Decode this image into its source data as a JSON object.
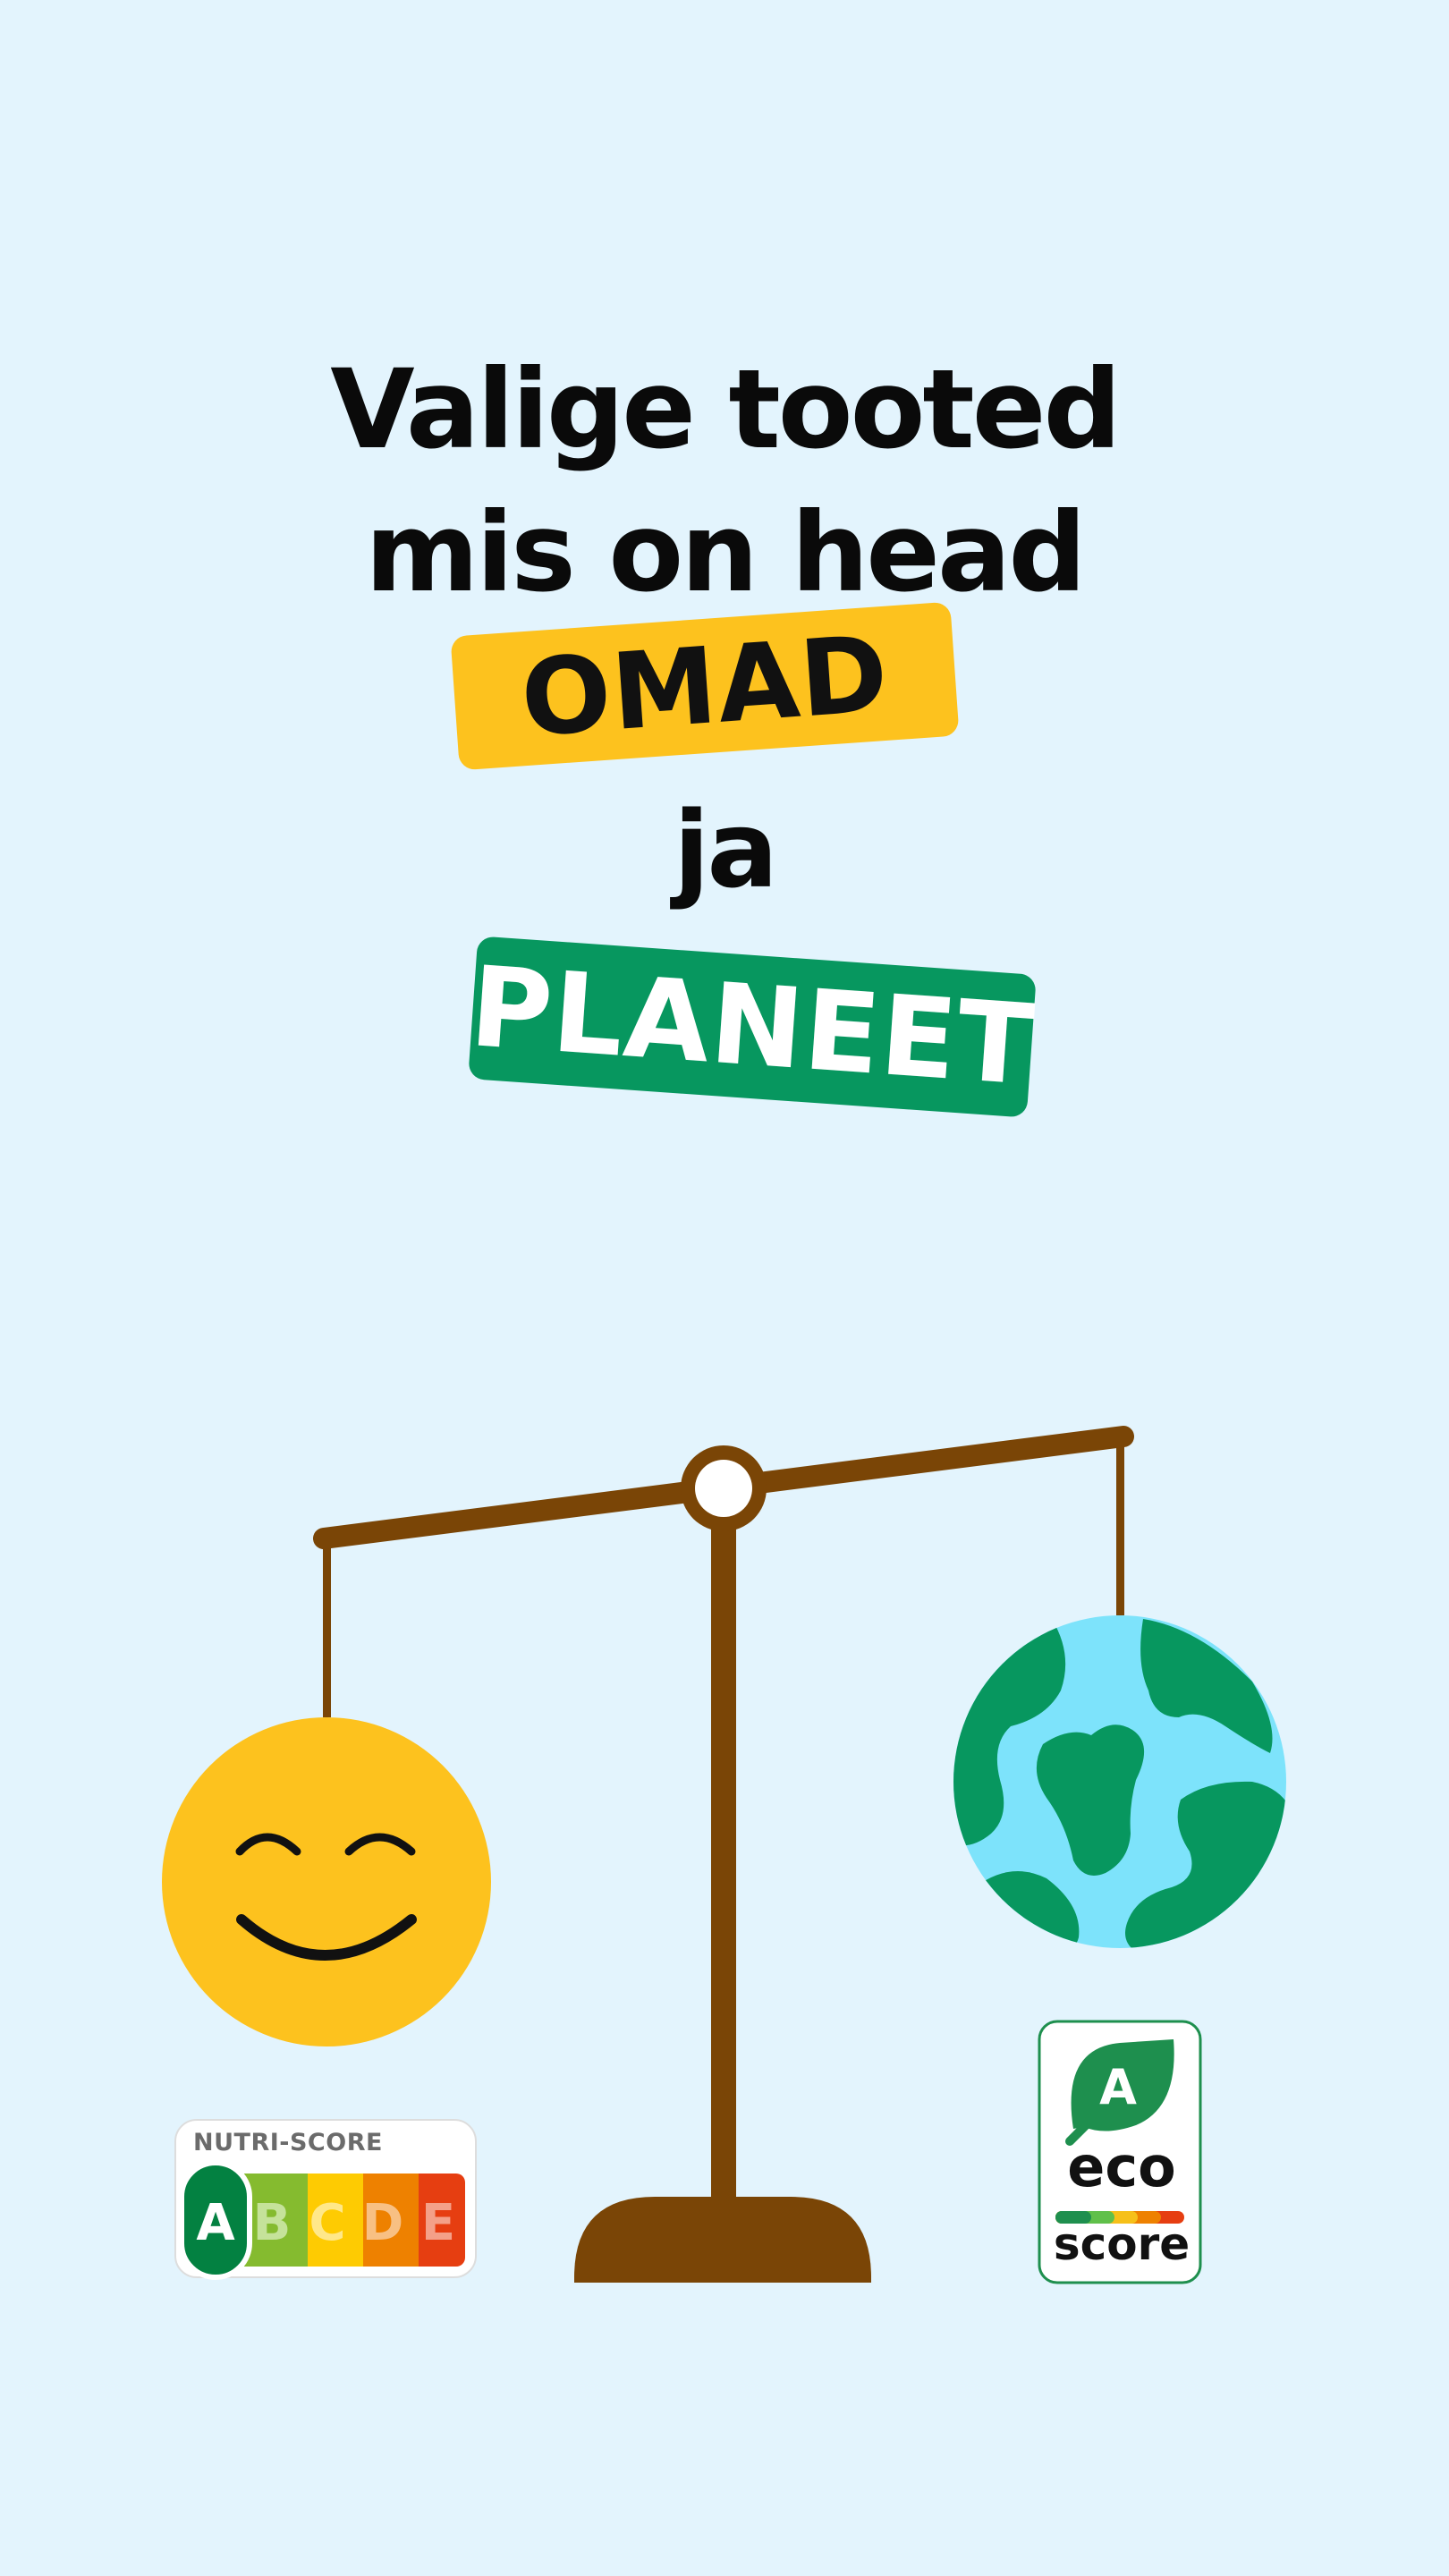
{
  "headline": {
    "line1": "Valige tooted",
    "line2": "mis on head",
    "highlight1": "OMAD",
    "connector": "ja",
    "highlight2": "PLANEET"
  },
  "colors": {
    "background": "#E3F4FD",
    "yellow": "#FDC21E",
    "green": "#07975F",
    "scale": "#7A4506",
    "earth_water": "#7DE3FB",
    "earth_land": "#07975F"
  },
  "illustration": {
    "scale_icon": "balance-scale-icon",
    "left_pan_icon": "smiley-face-icon",
    "right_pan_icon": "earth-globe-icon"
  },
  "nutri_score": {
    "title": "NUTRI-SCORE",
    "grades": [
      "A",
      "B",
      "C",
      "D",
      "E"
    ],
    "selected": "A",
    "grade_colors": [
      "#038141",
      "#85BB2F",
      "#FECB02",
      "#EE8100",
      "#E63E11"
    ]
  },
  "eco_score": {
    "grade": "A",
    "word1": "eco",
    "word2": "score",
    "leaf_icon": "leaf-icon",
    "bar_colors": [
      "#1E8F4E",
      "#60C04A",
      "#F6C019",
      "#EE8100",
      "#E63E11"
    ]
  }
}
